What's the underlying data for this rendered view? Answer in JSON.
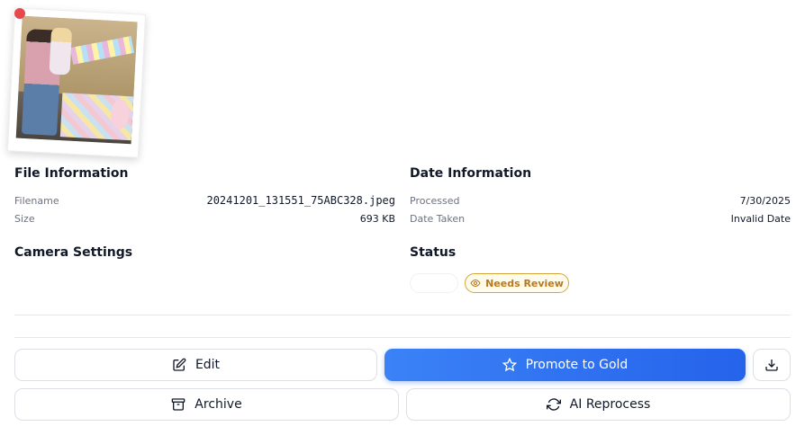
{
  "indicator_color": "#e5484d",
  "file_info": {
    "title": "File Information",
    "filename_label": "Filename",
    "filename_value": "20241201_131551_75ABC328.jpeg",
    "size_label": "Size",
    "size_value": "693 KB"
  },
  "date_info": {
    "title": "Date Information",
    "processed_label": "Processed",
    "processed_value": "7/30/2025",
    "date_taken_label": "Date Taken",
    "date_taken_value": "Invalid Date"
  },
  "camera": {
    "title": "Camera Settings"
  },
  "status": {
    "title": "Status",
    "badge_label": "Needs Review",
    "badge_icon": "eye-icon",
    "badge_color": "#b7791f"
  },
  "actions": {
    "edit_label": "Edit",
    "promote_label": "Promote to Gold",
    "download_icon": "download-icon",
    "archive_label": "Archive",
    "reprocess_label": "AI Reprocess"
  }
}
